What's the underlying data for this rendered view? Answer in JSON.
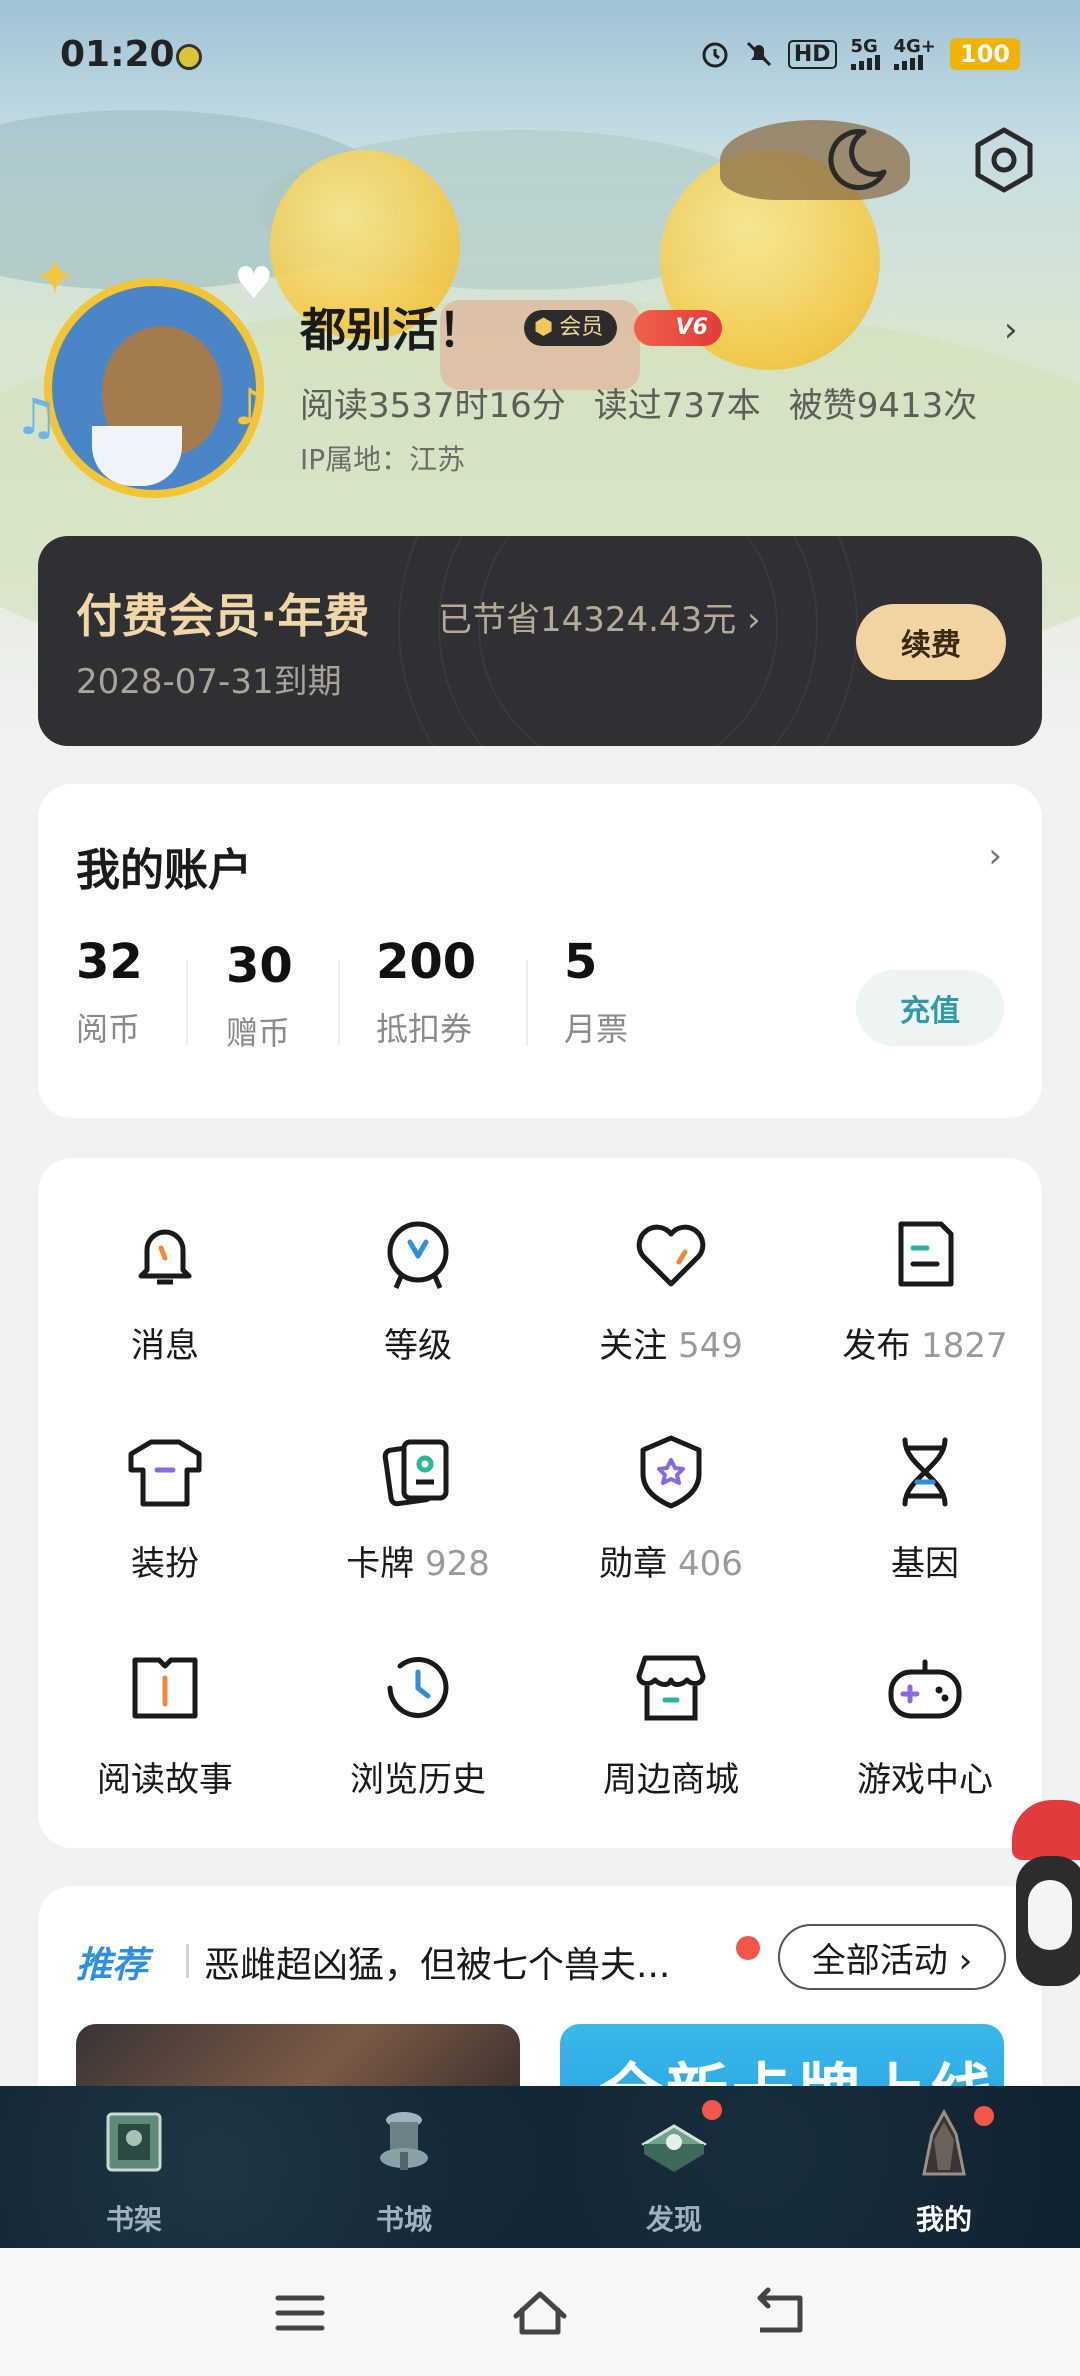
{
  "status_bar": {
    "time": "01:20",
    "icons": [
      "alarm-icon",
      "mute-icon",
      "hd-icon",
      "signal-5g-icon",
      "signal-4g-icon"
    ],
    "hd": "HD",
    "net1": "5G",
    "net2": "4G+",
    "battery": "100"
  },
  "header": {
    "night_mode_icon": "moon-icon",
    "settings_icon": "gear-icon"
  },
  "profile": {
    "name": "都别活！",
    "member_badge": "会员",
    "vip_badge": "V6",
    "stats": [
      "阅读3537时16分",
      "读过737本",
      "被赞9413次"
    ],
    "ip": "IP属地：江苏"
  },
  "membership": {
    "title": "付费会员·年费",
    "saved": "已节省14324.43元 ›",
    "expiry": "2028-07-31到期",
    "renew_label": "续费"
  },
  "account": {
    "title": "我的账户",
    "items": [
      {
        "value": "32",
        "label": "阅币"
      },
      {
        "value": "30",
        "label": "赠币"
      },
      {
        "value": "200",
        "label": "抵扣券"
      },
      {
        "value": "5",
        "label": "月票"
      }
    ],
    "recharge_label": "充值"
  },
  "features": [
    {
      "label": "消息",
      "count": "",
      "icon": "bell-icon"
    },
    {
      "label": "等级",
      "count": "",
      "icon": "level-icon"
    },
    {
      "label": "关注",
      "count": "549",
      "icon": "heart-icon"
    },
    {
      "label": "发布",
      "count": "1827",
      "icon": "publish-icon"
    },
    {
      "label": "装扮",
      "count": "",
      "icon": "tshirt-icon"
    },
    {
      "label": "卡牌",
      "count": "928",
      "icon": "cards-icon"
    },
    {
      "label": "勋章",
      "count": "406",
      "icon": "medal-icon"
    },
    {
      "label": "基因",
      "count": "",
      "icon": "dna-icon"
    },
    {
      "label": "阅读故事",
      "count": "",
      "icon": "book-icon"
    },
    {
      "label": "浏览历史",
      "count": "",
      "icon": "history-icon"
    },
    {
      "label": "周边商城",
      "count": "",
      "icon": "shop-icon"
    },
    {
      "label": "游戏中心",
      "count": "",
      "icon": "gamepad-icon"
    }
  ],
  "recommend": {
    "tag": "推荐",
    "text": "恶雌超凶猛，但被七个兽夫...",
    "all_label": "全部活动 ›",
    "banner2_text": "全新卡牌上线"
  },
  "tabs": [
    {
      "label": "书架",
      "icon": "bookshelf-icon",
      "active": false,
      "dot": false
    },
    {
      "label": "书城",
      "icon": "bookstore-icon",
      "active": false,
      "dot": false
    },
    {
      "label": "发现",
      "icon": "discover-icon",
      "active": false,
      "dot": true
    },
    {
      "label": "我的",
      "icon": "profile-icon",
      "active": true,
      "dot": true
    }
  ],
  "nav": [
    "menu-icon",
    "home-icon",
    "back-icon"
  ]
}
